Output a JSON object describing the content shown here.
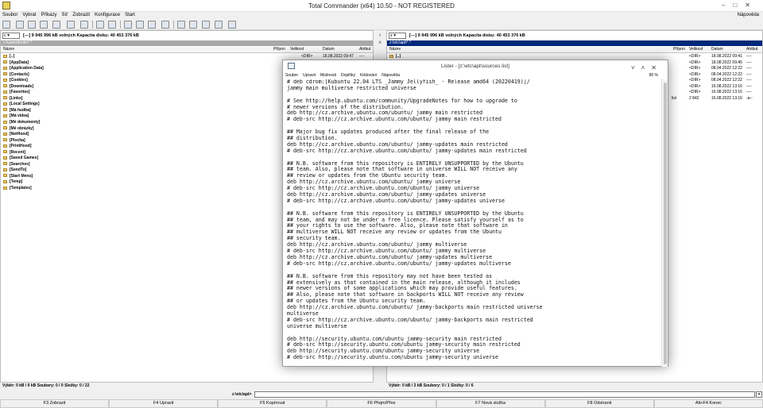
{
  "window": {
    "title": "Total Commander (x64) 10.50 - NOT REGISTERED"
  },
  "menu": {
    "items": [
      "Soubor",
      "Vybrat",
      "Příkazy",
      "Síť",
      "Zobrazit",
      "Konfigurace",
      "Start"
    ],
    "help": "Nápověda"
  },
  "left_panel": {
    "drive": "c",
    "drive_info": "[---]  9 945 996 kB volných  Kapacita disku: 40 453 376 kB",
    "path": "c:\\users\\tomk\\*.*",
    "columns": {
      "name": "Název",
      "ext": "Přípon",
      "size": "Velikost",
      "date": "Datum",
      "attr": "Atribut"
    },
    "rows": [
      {
        "name": "[..]",
        "ext": "",
        "size": "<DIR>",
        "date": "18.08.2022 09:47",
        "attr": "----"
      },
      {
        "name": "[AppData]"
      },
      {
        "name": "[Application Data]"
      },
      {
        "name": "[Contacts]"
      },
      {
        "name": "[Cookies]"
      },
      {
        "name": "[Downloads]"
      },
      {
        "name": "[Favorites]"
      },
      {
        "name": "[Links]"
      },
      {
        "name": "[Local Settings]"
      },
      {
        "name": "[Má hudba]"
      },
      {
        "name": "[Má videa]"
      },
      {
        "name": "[Mé dokumenty]"
      },
      {
        "name": "[Mé obrázky]"
      },
      {
        "name": "[NetHood]"
      },
      {
        "name": "[Plocha]"
      },
      {
        "name": "[PrintHood]"
      },
      {
        "name": "[Recent]"
      },
      {
        "name": "[Saved Games]"
      },
      {
        "name": "[Searches]"
      },
      {
        "name": "[SendTo]"
      },
      {
        "name": "[Start Menu]"
      },
      {
        "name": "[Temp]"
      },
      {
        "name": "[Templates]"
      }
    ],
    "status": "Výběr: 0 kB / 0 kB   Soubory: 0 / 0   Složky: 0 / 22"
  },
  "right_panel": {
    "drive": "z",
    "drive_info": "[---]  9 945 996 kB volných  Kapacita disku: 40 453 376 kB",
    "path": "z:\\etc\\apt\\*.*",
    "columns": {
      "name": "Název",
      "ext": "Přípon",
      "size": "Velikost",
      "date": "Datum",
      "attr": "Atribut"
    },
    "rows": [
      {
        "name": "[..]",
        "ext": "",
        "size": "<DIR>",
        "date": "18.08.2022 09:41",
        "attr": "----"
      },
      {
        "name": "",
        "ext": "",
        "size": "<DIR>",
        "date": "18.08.2022 09:45",
        "attr": "----"
      },
      {
        "name": "",
        "ext": "",
        "size": "<DIR>",
        "date": "08.04.2022 12:22",
        "attr": "----"
      },
      {
        "name": "",
        "ext": "",
        "size": "<DIR>",
        "date": "08.04.2022 12:22",
        "attr": "----"
      },
      {
        "name": "",
        "ext": "",
        "size": "<DIR>",
        "date": "08.04.2022 12:22",
        "attr": "----"
      },
      {
        "name": "",
        "ext": "",
        "size": "<DIR>",
        "date": "16.08.2022 13:16",
        "attr": "----"
      },
      {
        "name": "",
        "ext": "",
        "size": "<DIR>",
        "date": "16.08.2022 13:16",
        "attr": "----"
      },
      {
        "name": "",
        "ext": "list",
        "size": "2 842",
        "date": "16.08.2022 13:16",
        "attr": "-a--"
      }
    ],
    "status": "Výběr: 0 kB / 2 kB   Soubory: 0 / 1   Složky: 0 / 6"
  },
  "command_line": {
    "prompt": "z:\\etc\\apt>",
    "value": ""
  },
  "function_keys": [
    "F3 Zobrazit",
    "F4 Upravit",
    "F5 Kopírovat",
    "F6 Přejm/Přes",
    "F7 Nová složka",
    "F8 Odstranit",
    "Alt+F4 Konec"
  ],
  "lister": {
    "title": "Lister - [z:\\etc\\apt\\sources.list]",
    "menu": [
      "Soubor",
      "Upravit",
      "Možnosti",
      "Doplňky",
      "Kódování",
      "Nápověda"
    ],
    "percent": "90 %",
    "lines": [
      "# deb cdrom:[Kubuntu 22.04 LTS _Jammy Jellyfish_ - Release amd64 (20220419)]/",
      "jammy main multiverse restricted universe",
      "",
      "# See http://help.ubuntu.com/community/UpgradeNotes for how to upgrade to",
      "# newer versions of the distribution.",
      "deb http://cz.archive.ubuntu.com/ubuntu/ jammy main restricted",
      "# deb-src http://cz.archive.ubuntu.com/ubuntu/ jammy main restricted",
      "",
      "## Major bug fix updates produced after the final release of the",
      "## distribution.",
      "deb http://cz.archive.ubuntu.com/ubuntu/ jammy-updates main restricted",
      "# deb-src http://cz.archive.ubuntu.com/ubuntu/ jammy-updates main restricted",
      "",
      "## N.B. software from this repository is ENTIRELY UNSUPPORTED by the Ubuntu",
      "## team. Also, please note that software in universe WILL NOT receive any",
      "## review or updates from the Ubuntu security team.",
      "deb http://cz.archive.ubuntu.com/ubuntu/ jammy universe",
      "# deb-src http://cz.archive.ubuntu.com/ubuntu/ jammy universe",
      "deb http://cz.archive.ubuntu.com/ubuntu/ jammy-updates universe",
      "# deb-src http://cz.archive.ubuntu.com/ubuntu/ jammy-updates universe",
      "",
      "## N.B. software from this repository is ENTIRELY UNSUPPORTED by the Ubuntu",
      "## team, and may not be under a free licence. Please satisfy yourself as to",
      "## your rights to use the software. Also, please note that software in",
      "## multiverse WILL NOT receive any review or updates from the Ubuntu",
      "## security team.",
      "deb http://cz.archive.ubuntu.com/ubuntu/ jammy multiverse",
      "# deb-src http://cz.archive.ubuntu.com/ubuntu/ jammy multiverse",
      "deb http://cz.archive.ubuntu.com/ubuntu/ jammy-updates multiverse",
      "# deb-src http://cz.archive.ubuntu.com/ubuntu/ jammy-updates multiverse",
      "",
      "## N.B. software from this repository may not have been tested as",
      "## extensively as that contained in the main release, although it includes",
      "## newer versions of some applications which may provide useful features.",
      "## Also, please note that software in backports WILL NOT receive any review",
      "## or updates from the Ubuntu security team.",
      "deb http://cz.archive.ubuntu.com/ubuntu/ jammy-backports main restricted universe",
      "multiverse",
      "# deb-src http://cz.archive.ubuntu.com/ubuntu/ jammy-backports main restricted",
      "universe multiverse",
      "",
      "deb http://security.ubuntu.com/ubuntu jammy-security main restricted",
      "# deb-src http://security.ubuntu.com/ubuntu jammy-security main restricted",
      "deb http://security.ubuntu.com/ubuntu jammy-security universe",
      "# deb-src http://security.ubuntu.com/ubuntu jammy-security universe"
    ]
  },
  "colors": {
    "active_path": "#00287a",
    "inactive_path": "#a8a8a8",
    "folder": "#e9c668"
  }
}
